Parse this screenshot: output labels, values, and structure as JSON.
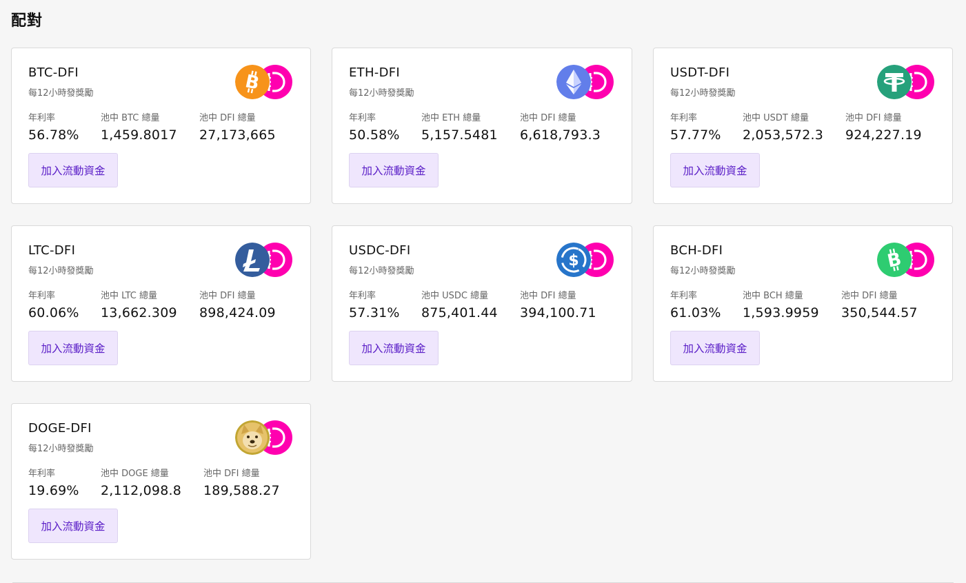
{
  "page": {
    "title": "配對"
  },
  "colors": {
    "dfi": "#ff00af",
    "button_bg": "#efe6fd",
    "button_text": "#5a1ec7"
  },
  "labels": {
    "reward_note": "每12小時發獎勵",
    "apr_label": "年利率",
    "add_button": "加入流動資金"
  },
  "pairs": [
    {
      "name": "BTC-DFI",
      "coin_icon": "btc-icon",
      "coin_color": "#f7931a",
      "apr": "56.78%",
      "pool_a_label": "池中 BTC 總量",
      "pool_a": "1,459.8017",
      "pool_b_label": "池中 DFI 總量",
      "pool_b": "27,173,665"
    },
    {
      "name": "ETH-DFI",
      "coin_icon": "eth-icon",
      "coin_color": "#627eea",
      "apr": "50.58%",
      "pool_a_label": "池中 ETH 總量",
      "pool_a": "5,157.5481",
      "pool_b_label": "池中 DFI 總量",
      "pool_b": "6,618,793.3"
    },
    {
      "name": "USDT-DFI",
      "coin_icon": "usdt-icon",
      "coin_color": "#26a17b",
      "apr": "57.77%",
      "pool_a_label": "池中 USDT 總量",
      "pool_a": "2,053,572.3",
      "pool_b_label": "池中 DFI 總量",
      "pool_b": "924,227.19"
    },
    {
      "name": "LTC-DFI",
      "coin_icon": "ltc-icon",
      "coin_color": "#345d9d",
      "apr": "60.06%",
      "pool_a_label": "池中 LTC 總量",
      "pool_a": "13,662.309",
      "pool_b_label": "池中 DFI 總量",
      "pool_b": "898,424.09"
    },
    {
      "name": "USDC-DFI",
      "coin_icon": "usdc-icon",
      "coin_color": "#2775ca",
      "apr": "57.31%",
      "pool_a_label": "池中 USDC 總量",
      "pool_a": "875,401.44",
      "pool_b_label": "池中 DFI 總量",
      "pool_b": "394,100.71"
    },
    {
      "name": "BCH-DFI",
      "coin_icon": "bch-icon",
      "coin_color": "#2ecc71",
      "apr": "61.03%",
      "pool_a_label": "池中 BCH 總量",
      "pool_a": "1,593.9959",
      "pool_b_label": "池中 DFI 總量",
      "pool_b": "350,544.57"
    },
    {
      "name": "DOGE-DFI",
      "coin_icon": "doge-icon",
      "coin_color": "#c2a633",
      "apr": "19.69%",
      "pool_a_label": "池中 DOGE 總量",
      "pool_a": "2,112,098.8",
      "pool_b_label": "池中 DFI 總量",
      "pool_b": "189,588.27"
    }
  ]
}
